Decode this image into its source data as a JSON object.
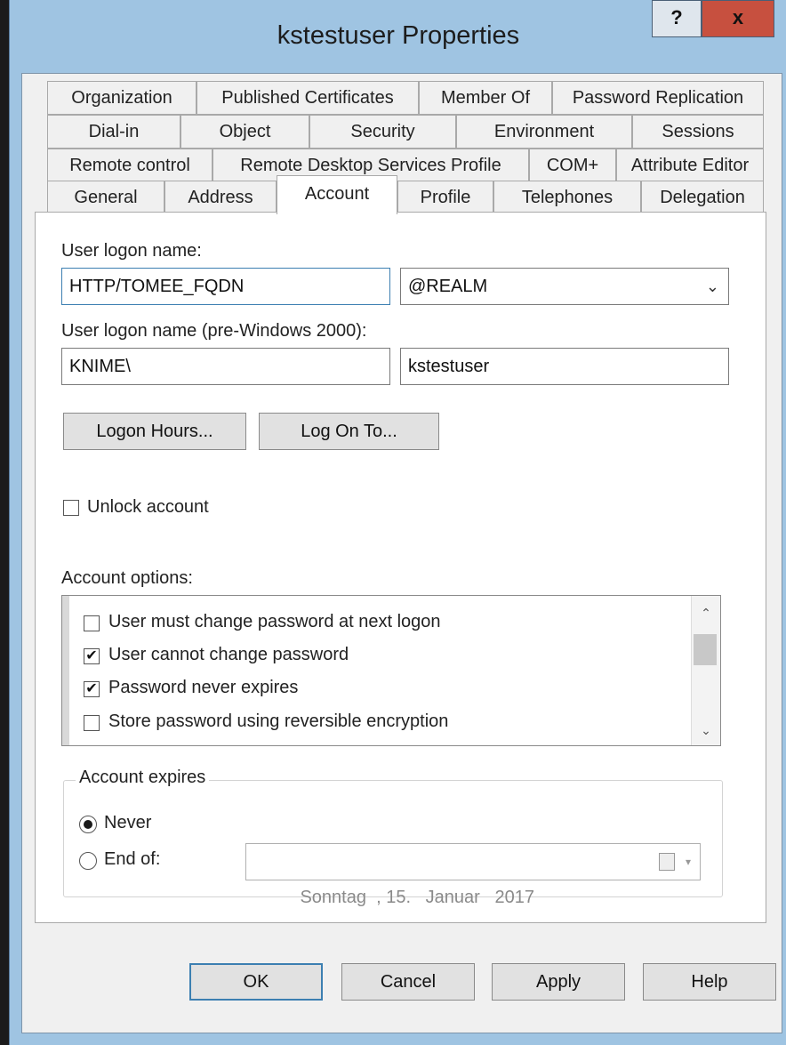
{
  "window": {
    "title": "kstestuser Properties",
    "help_label": "?",
    "close_label": "x"
  },
  "tabs": {
    "row1": [
      "Organization",
      "Published Certificates",
      "Member Of",
      "Password Replication"
    ],
    "row2": [
      "Dial-in",
      "Object",
      "Security",
      "Environment",
      "Sessions"
    ],
    "row3": [
      "Remote control",
      "Remote Desktop Services Profile",
      "COM+",
      "Attribute Editor"
    ],
    "row4": [
      "General",
      "Address",
      "Account",
      "Profile",
      "Telephones",
      "Delegation"
    ],
    "active": "Account"
  },
  "account": {
    "logon_name_label": "User logon name:",
    "logon_name_value": "HTTP/TOMEE_FQDN",
    "domain_suffix": "@REALM",
    "prewin_label": "User logon name (pre-Windows 2000):",
    "prewin_domain": "KNIME\\",
    "prewin_user": "kstestuser",
    "logon_hours_button": "Logon Hours...",
    "log_on_to_button": "Log On To...",
    "unlock_label": "Unlock account",
    "options_label": "Account options:",
    "options": [
      {
        "label": "User must change password at next logon",
        "checked": false
      },
      {
        "label": "User cannot change password",
        "checked": true
      },
      {
        "label": "Password never expires",
        "checked": true
      },
      {
        "label": "Store password using reversible encryption",
        "checked": false
      }
    ],
    "expires_label": "Account expires",
    "never_label": "Never",
    "end_of_label": "End of:",
    "end_date": "Sonntag  , 15.   Januar   2017",
    "expires_selected": "Never"
  },
  "footer": {
    "ok": "OK",
    "cancel": "Cancel",
    "apply": "Apply",
    "help": "Help"
  },
  "colors": {
    "window_frame": "#9fc4e2",
    "close_button": "#c7503f",
    "accent_border": "#3c7fb1"
  },
  "icons": [
    "checkmark-icon",
    "chevron-down-icon",
    "calendar-icon",
    "scroll-up-icon",
    "scroll-down-icon"
  ]
}
